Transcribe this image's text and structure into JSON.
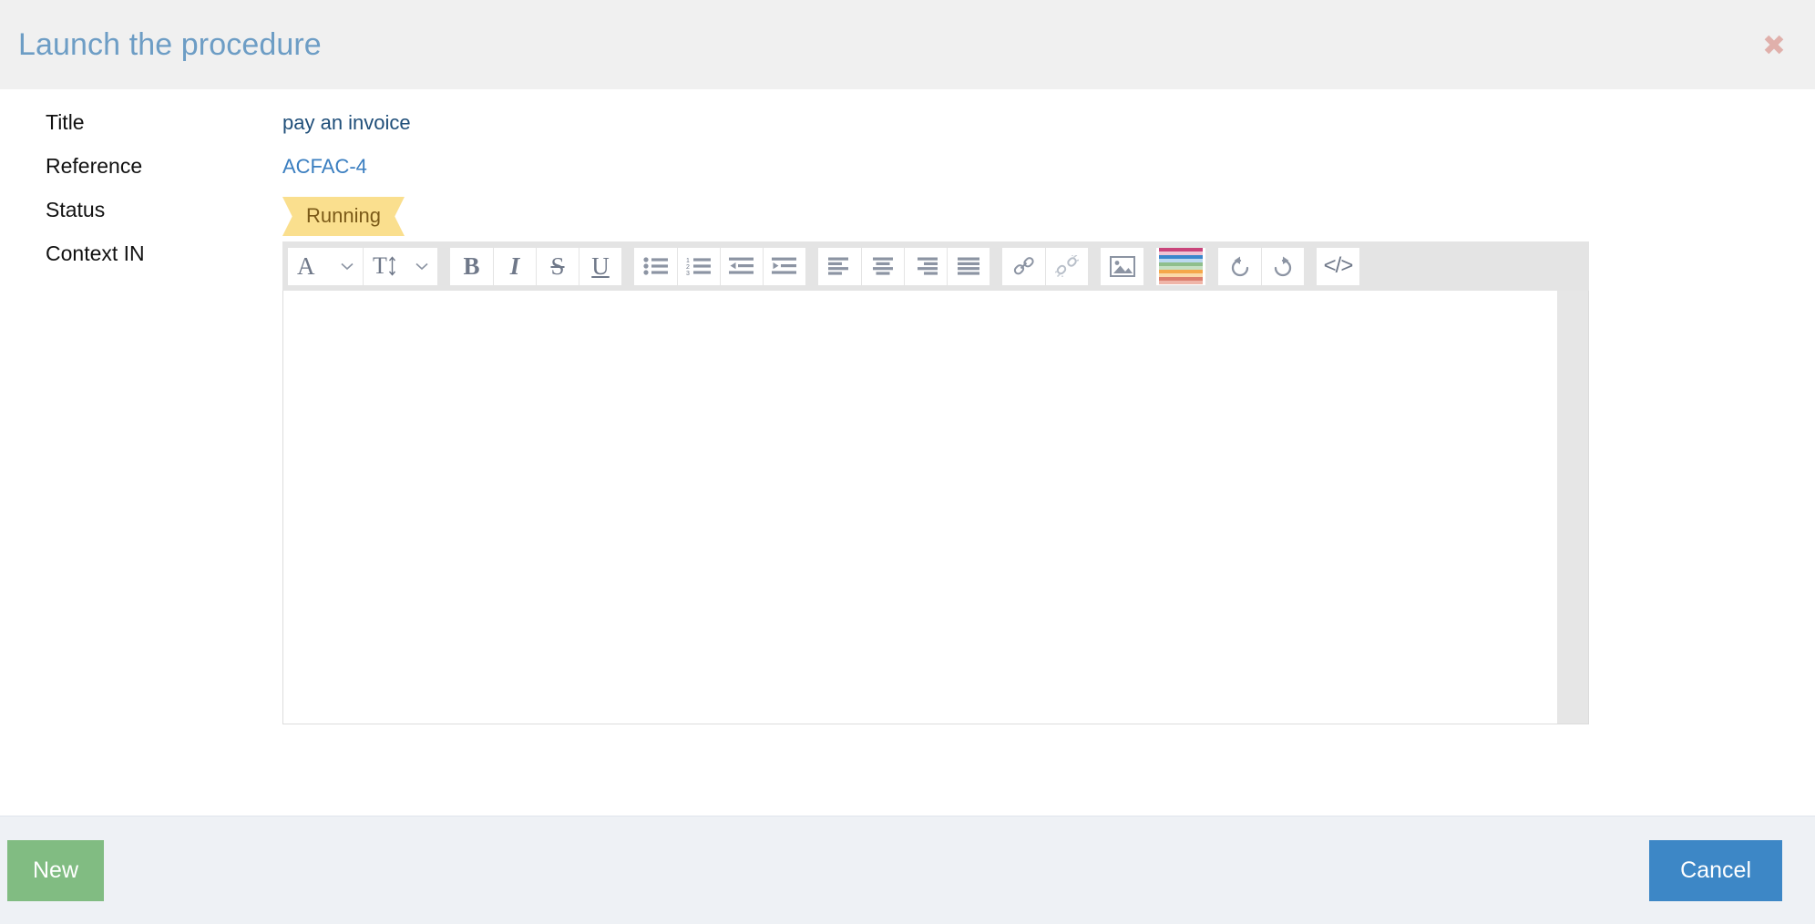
{
  "header": {
    "title": "Launch the procedure",
    "close_icon": "close-x-icon",
    "close_color": "#e0b0ab",
    "background": "#f0f0f0",
    "title_color": "#6d9dc5"
  },
  "form": {
    "rows": [
      {
        "label": "Title",
        "value": "pay an invoice",
        "kind": "text"
      },
      {
        "label": "Reference",
        "value": "ACFAC-4",
        "kind": "link"
      },
      {
        "label": "Status",
        "value": "Running",
        "kind": "ribbon"
      },
      {
        "label": "Context IN",
        "value": "",
        "kind": "editor"
      }
    ]
  },
  "status_badge": {
    "text": "Running",
    "background": "#fadf8e",
    "text_color": "#7b5a18"
  },
  "editor": {
    "content": "",
    "toolbar_background": "#e4e4e4",
    "groups": [
      {
        "name": "font-group",
        "buttons": [
          {
            "name": "font-family-button",
            "icon": "font-family-icon",
            "label": "A",
            "has_chevron": true
          },
          {
            "name": "font-size-button",
            "icon": "font-size-icon",
            "label": "T",
            "has_chevron": true
          }
        ]
      },
      {
        "name": "text-style-group",
        "buttons": [
          {
            "name": "bold-button",
            "icon": "bold-icon",
            "label": "B"
          },
          {
            "name": "italic-button",
            "icon": "italic-icon",
            "label": "I"
          },
          {
            "name": "strikethrough-button",
            "icon": "strikethrough-icon",
            "label": "S"
          },
          {
            "name": "underline-button",
            "icon": "underline-icon",
            "label": "U"
          }
        ]
      },
      {
        "name": "list-group",
        "buttons": [
          {
            "name": "bullet-list-button",
            "icon": "bullet-list-icon"
          },
          {
            "name": "numbered-list-button",
            "icon": "numbered-list-icon"
          },
          {
            "name": "outdent-button",
            "icon": "outdent-icon"
          },
          {
            "name": "indent-button",
            "icon": "indent-icon"
          }
        ]
      },
      {
        "name": "align-group",
        "buttons": [
          {
            "name": "align-left-button",
            "icon": "align-left-icon"
          },
          {
            "name": "align-center-button",
            "icon": "align-center-icon"
          },
          {
            "name": "align-right-button",
            "icon": "align-right-icon"
          },
          {
            "name": "align-justify-button",
            "icon": "align-justify-icon"
          }
        ]
      },
      {
        "name": "link-group",
        "buttons": [
          {
            "name": "insert-link-button",
            "icon": "link-icon"
          },
          {
            "name": "remove-link-button",
            "icon": "unlink-icon"
          }
        ]
      },
      {
        "name": "media-group",
        "buttons": [
          {
            "name": "insert-image-button",
            "icon": "image-icon"
          }
        ]
      },
      {
        "name": "color-group",
        "buttons": [
          {
            "name": "text-color-button",
            "icon": "color-palette-icon"
          }
        ]
      },
      {
        "name": "history-group",
        "buttons": [
          {
            "name": "undo-button",
            "icon": "undo-icon"
          },
          {
            "name": "redo-button",
            "icon": "redo-icon"
          }
        ]
      },
      {
        "name": "source-group",
        "buttons": [
          {
            "name": "code-view-button",
            "icon": "code-icon",
            "label": "</>"
          }
        ]
      }
    ],
    "palette_colors": [
      "#c9447a",
      "#efc5d5",
      "#3a87cd",
      "#bcd9ef",
      "#8fbf8c",
      "#c6e0c2",
      "#f5a84a",
      "#fbd9a8",
      "#dc7f6d",
      "#efb5a8"
    ]
  },
  "footer": {
    "new_label": "New",
    "cancel_label": "Cancel",
    "new_color": "#81bc82",
    "cancel_color": "#3d87c6",
    "background": "#eef1f5"
  }
}
